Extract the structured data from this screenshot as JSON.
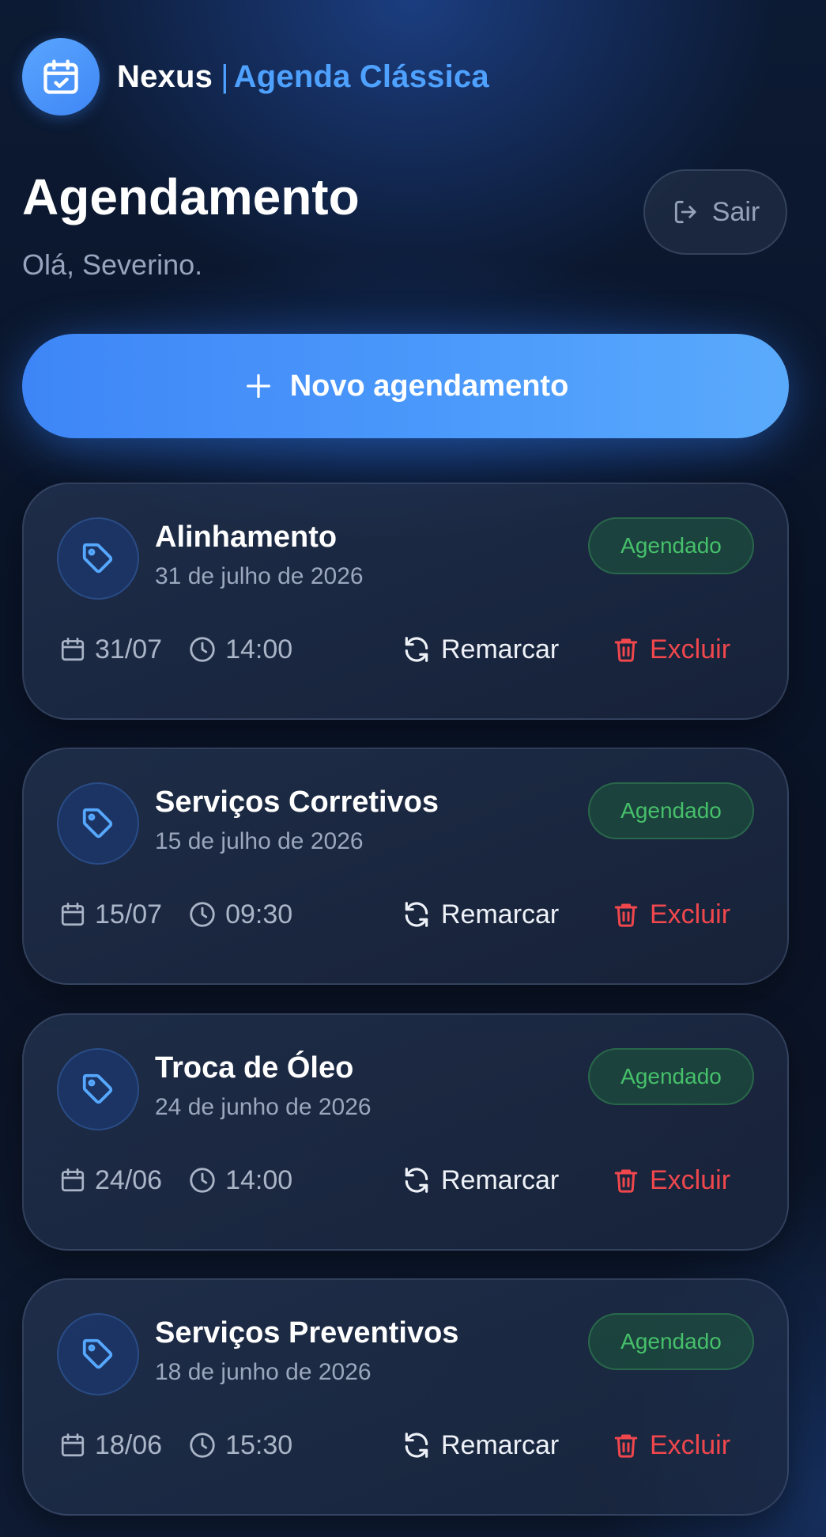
{
  "header": {
    "brand_name": "Nexus",
    "separator": "|",
    "brand_subtitle": "Agenda Clássica",
    "logo_icon": "calendar-check-icon"
  },
  "page": {
    "title": "Agendamento",
    "greeting": "Olá, Severino.",
    "logout_label": "Sair",
    "new_button_label": "Novo agendamento"
  },
  "colors": {
    "accent": "#4b99fb",
    "status_green": "#46c06a",
    "danger": "#f0474d"
  },
  "appointments": [
    {
      "service": "Alinhamento",
      "date_long": "31 de julho de 2026",
      "status": "Agendado",
      "date_short": "31/07",
      "time": "14:00",
      "reschedule_label": "Remarcar",
      "delete_label": "Excluir"
    },
    {
      "service": "Serviços Corretivos",
      "date_long": "15 de julho de 2026",
      "status": "Agendado",
      "date_short": "15/07",
      "time": "09:30",
      "reschedule_label": "Remarcar",
      "delete_label": "Excluir"
    },
    {
      "service": "Troca de Óleo",
      "date_long": "24 de junho de 2026",
      "status": "Agendado",
      "date_short": "24/06",
      "time": "14:00",
      "reschedule_label": "Remarcar",
      "delete_label": "Excluir"
    },
    {
      "service": "Serviços Preventivos",
      "date_long": "18 de junho de 2026",
      "status": "Agendado",
      "date_short": "18/06",
      "time": "15:30",
      "reschedule_label": "Remarcar",
      "delete_label": "Excluir"
    }
  ]
}
